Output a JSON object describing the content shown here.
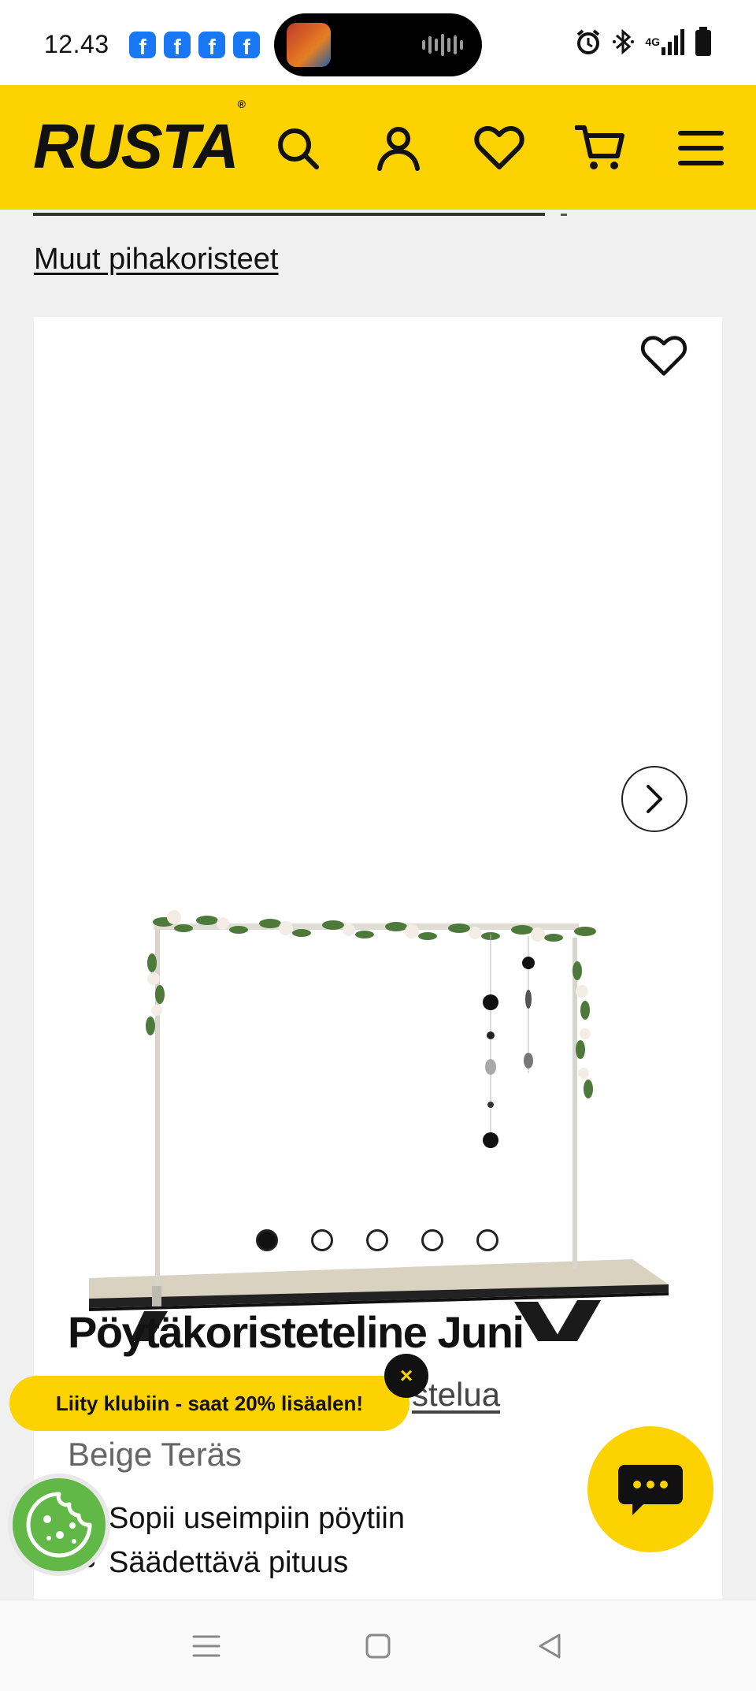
{
  "status_bar": {
    "time": "12.43",
    "notification_icons": [
      "facebook-icon",
      "facebook-icon",
      "facebook-icon",
      "facebook-icon"
    ],
    "network": "4G"
  },
  "header": {
    "logo": "RUSTA",
    "logo_mark": "®",
    "icons": [
      "search-icon",
      "account-icon",
      "wishlist-icon",
      "cart-icon",
      "menu-icon"
    ],
    "brand_color": "#fcd200"
  },
  "breadcrumb": {
    "current_link": "Muut pihakoristeet"
  },
  "product": {
    "title": "Pöytäkoristeteline Juni",
    "sub_link": "stelua",
    "variant": "Beige Teräs",
    "gallery_count": 5,
    "gallery_active_index": 0,
    "bullets": [
      "Sopii useimpiin pöytiin",
      "Säädettävä pituus"
    ]
  },
  "club_banner": {
    "text": "Liity klubiin - saat 20% lisäalen!",
    "close_symbol": "×"
  },
  "chat": {
    "icon": "chat-icon"
  },
  "cookie": {
    "icon": "cookie-icon"
  },
  "nav": {
    "buttons": [
      "recent-apps-icon",
      "home-icon",
      "back-icon"
    ]
  }
}
